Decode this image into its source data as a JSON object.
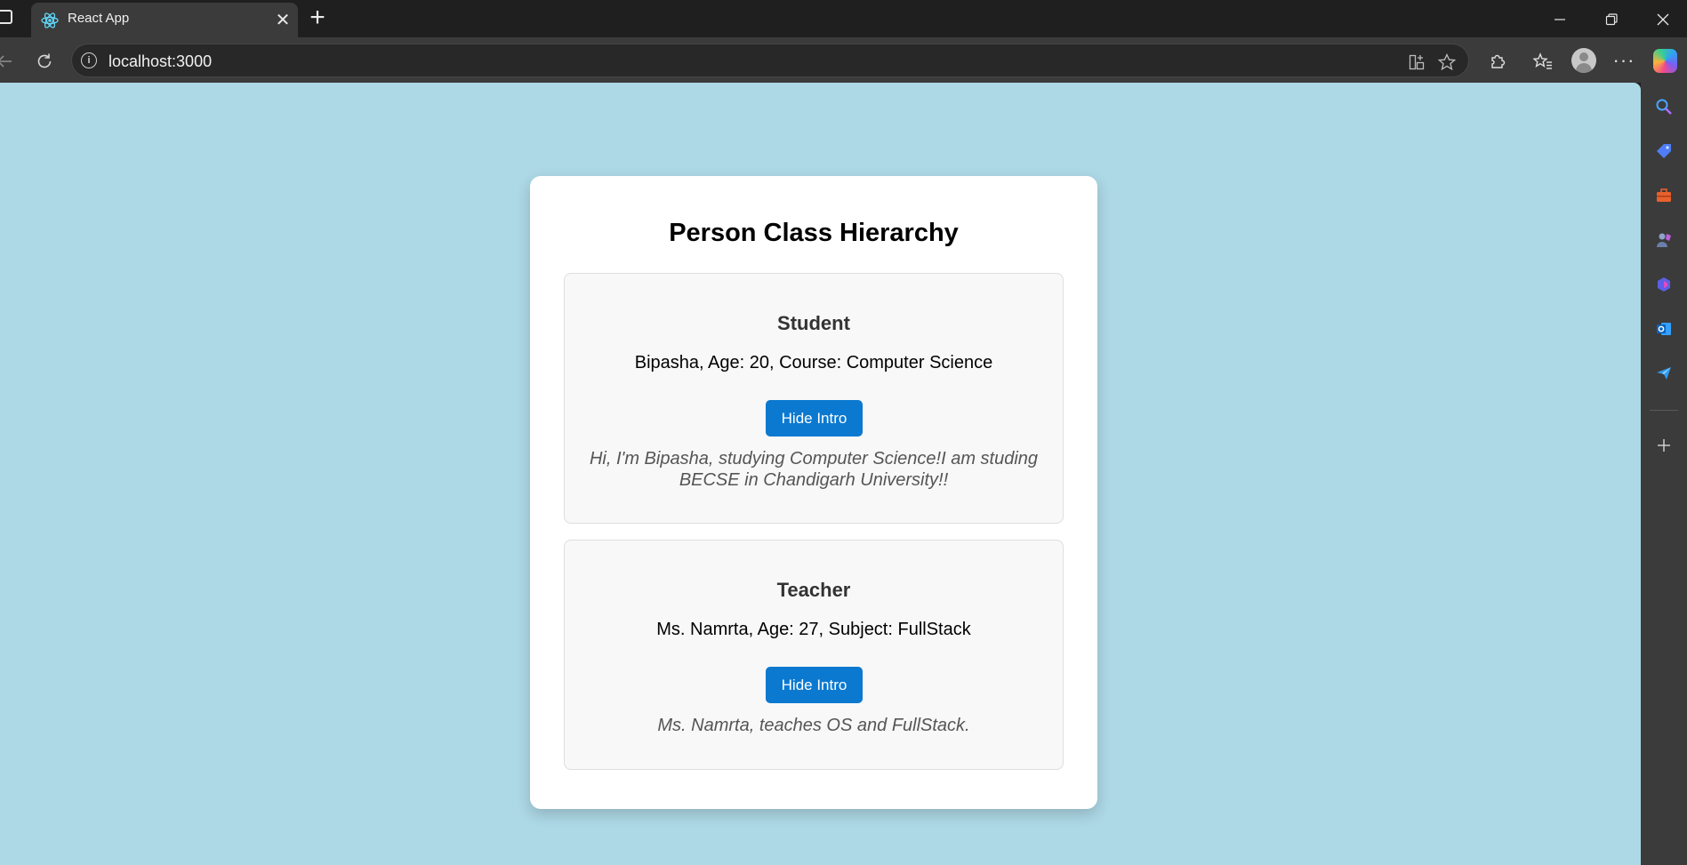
{
  "browser": {
    "tab_title": "React App",
    "url": "localhost:3000",
    "new_tab_symbol": "+",
    "tab_close_symbol": "✕",
    "icons": {
      "back": "back-arrow-icon",
      "reload": "reload-icon",
      "site_info": "info-icon",
      "app_grid": "app-available-icon",
      "favorite": "star-icon",
      "extensions": "puzzle-icon",
      "favorites": "favorites-icon",
      "profile": "avatar",
      "more": "more-icon",
      "copilot": "copilot-icon"
    },
    "window_controls": [
      "minimize",
      "restore",
      "close"
    ]
  },
  "sidebar": {
    "items": [
      "search-icon",
      "tag-icon",
      "toolbox-icon",
      "games-icon",
      "m365-icon",
      "outlook-icon",
      "send-icon",
      "add-icon"
    ]
  },
  "page": {
    "title": "Person Class Hierarchy",
    "background_color": "#add8e6",
    "button_color": "#0b79d0",
    "people": [
      {
        "role": "Student",
        "info": "Bipasha, Age: 20, Course: Computer Science",
        "button_label": "Hide Intro",
        "intro": "Hi, I'm Bipasha, studying Computer Science!I am studing BECSE in Chandigarh University!!"
      },
      {
        "role": "Teacher",
        "info": "Ms. Namrta, Age: 27, Subject: FullStack",
        "button_label": "Hide Intro",
        "intro": "Ms. Namrta, teaches OS and FullStack."
      }
    ]
  }
}
